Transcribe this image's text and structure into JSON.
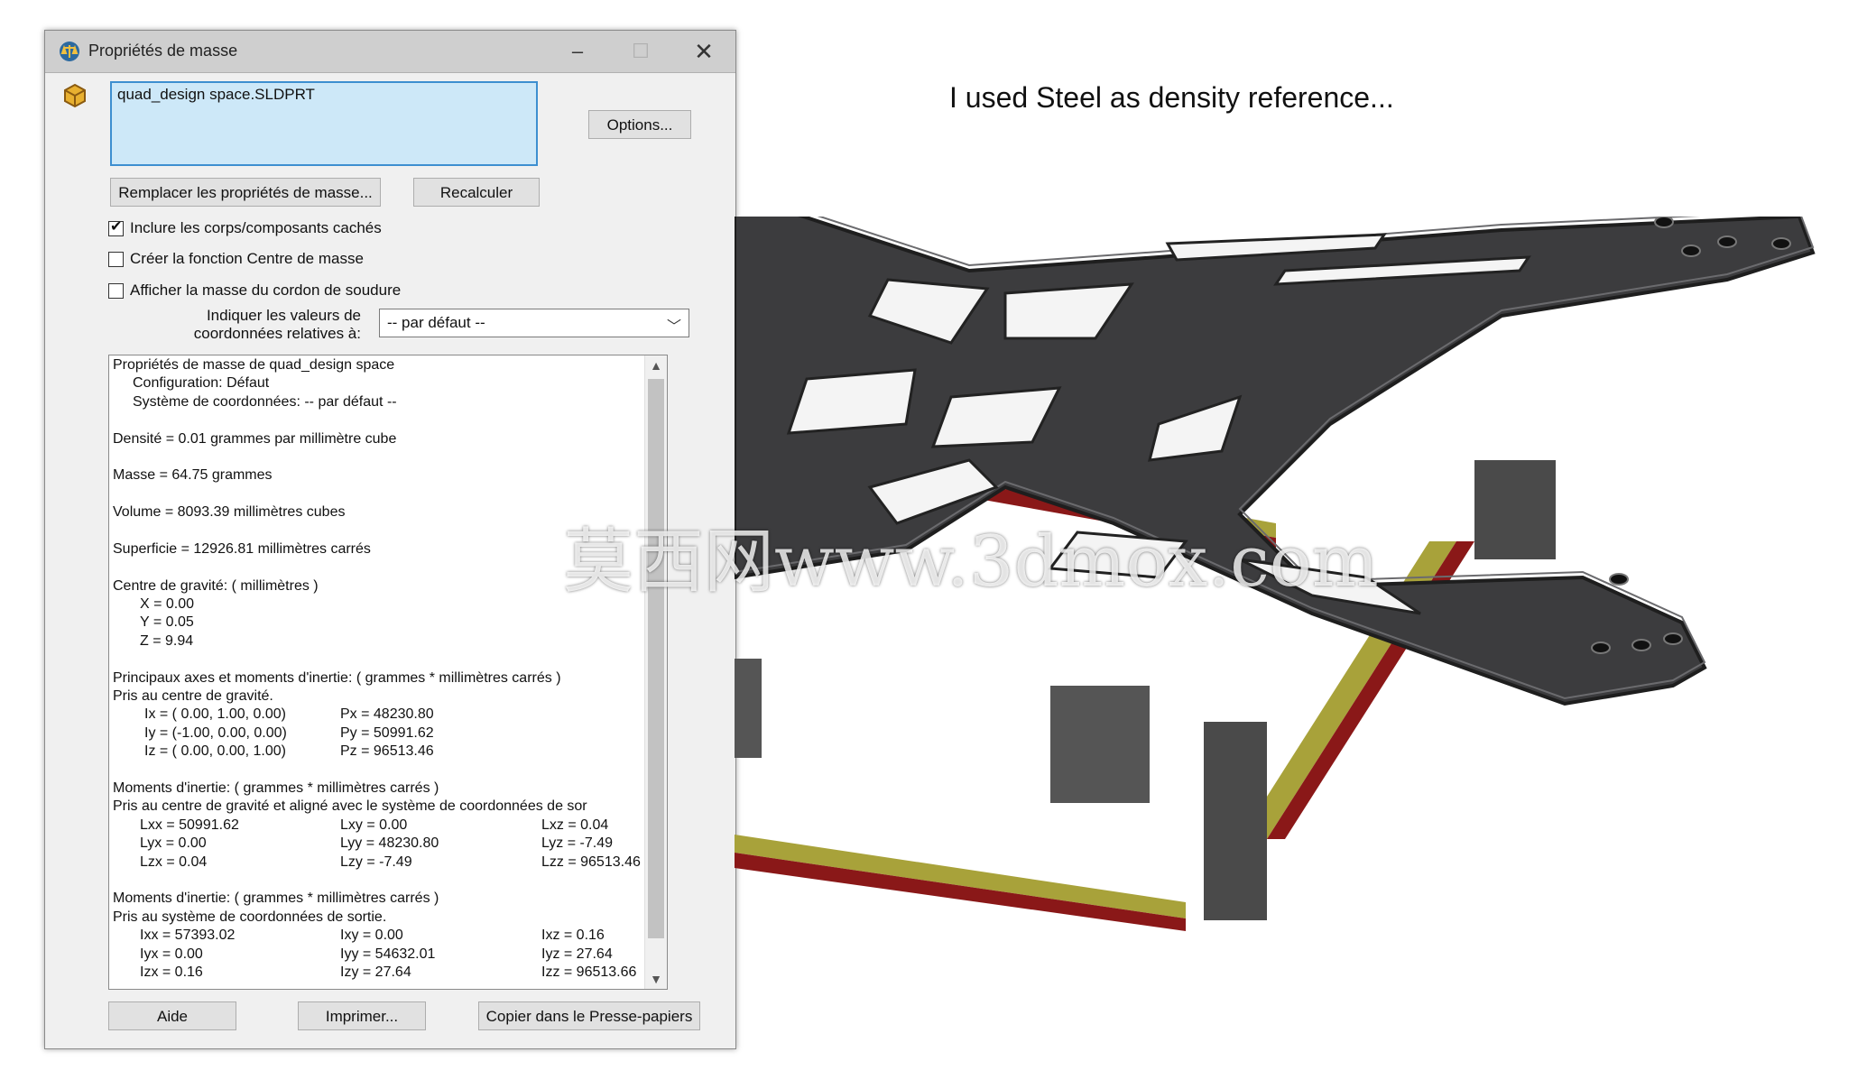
{
  "window": {
    "title": "Propriétés de masse",
    "minimize_glyph": "–",
    "maximize_glyph": "☐",
    "close_glyph": "✕"
  },
  "selection": {
    "item": "quad_design space.SLDPRT"
  },
  "buttons": {
    "options": "Options...",
    "replace": "Remplacer les propriétés de masse...",
    "recalculate": "Recalculer",
    "help": "Aide",
    "print": "Imprimer...",
    "copy": "Copier dans le Presse-papiers"
  },
  "checkboxes": [
    {
      "label": "Inclure les corps/composants cachés",
      "checked": true
    },
    {
      "label": "Créer la fonction Centre de masse",
      "checked": false
    },
    {
      "label": "Afficher la masse du cordon de soudure",
      "checked": false
    }
  ],
  "coordinates": {
    "label_line1": "Indiquer les valeurs de",
    "label_line2": "coordonnées relatives à:",
    "selected": "-- par défaut --"
  },
  "results": {
    "header": "Propriétés de masse de quad_design space",
    "configuration": "Configuration: Défaut",
    "coord_system": "Système de coordonnées: -- par défaut --",
    "density": "Densité = 0.01 grammes par millimètre cube",
    "mass": "Masse = 64.75 grammes",
    "volume": "Volume = 8093.39 millimètres cubes",
    "surface": "Superficie = 12926.81  millimètres carrés",
    "cog_title": "Centre de gravité: ( millimètres )",
    "cog_x": "X = 0.00",
    "cog_y": "Y = 0.05",
    "cog_z": "Z = 9.94",
    "principal_title": "Principaux axes et moments d'inertie: ( grammes *  millimètres carrés )",
    "principal_sub": "Pris au centre de gravité.",
    "principal_rows": [
      {
        "axis": "Ix = ( 0.00,  1.00,  0.00)",
        "moment": "Px = 48230.80"
      },
      {
        "axis": "Iy = (-1.00,  0.00,  0.00)",
        "moment": "Py = 50991.62"
      },
      {
        "axis": "Iz = ( 0.00,  0.00,  1.00)",
        "moment": "Pz = 96513.46"
      }
    ],
    "moments1_title": "Moments d'inertie: ( grammes *  millimètres carrés )",
    "moments1_sub": "Pris au centre de gravité et aligné avec le système de coordonnées de sor",
    "moments1_rows": [
      [
        "Lxx = 50991.62",
        "Lxy = 0.00",
        "Lxz = 0.04"
      ],
      [
        "Lyx = 0.00",
        "Lyy = 48230.80",
        "Lyz = -7.49"
      ],
      [
        "Lzx = 0.04",
        "Lzy = -7.49",
        "Lzz = 96513.46"
      ]
    ],
    "moments2_title": "Moments d'inertie: ( grammes *  millimètres carrés )",
    "moments2_sub": "Pris au système de coordonnées de sortie.",
    "moments2_rows": [
      [
        "Ixx = 57393.02",
        "Ixy = 0.00",
        "Ixz = 0.16"
      ],
      [
        "Iyx = 0.00",
        "Iyy = 54632.01",
        "Iyz = 27.64"
      ],
      [
        "Izx = 0.16",
        "Izy = 27.64",
        "Izz = 96513.66"
      ]
    ]
  },
  "caption": "I used Steel as density reference...",
  "watermark": "莫西网www.3dmox.com",
  "colors": {
    "frame": "#3c3c3e",
    "rail_red": "#8a1818",
    "rail_yellow": "#a8a23a",
    "selection_bg": "#cde8f8",
    "selection_border": "#3d8fd0"
  }
}
